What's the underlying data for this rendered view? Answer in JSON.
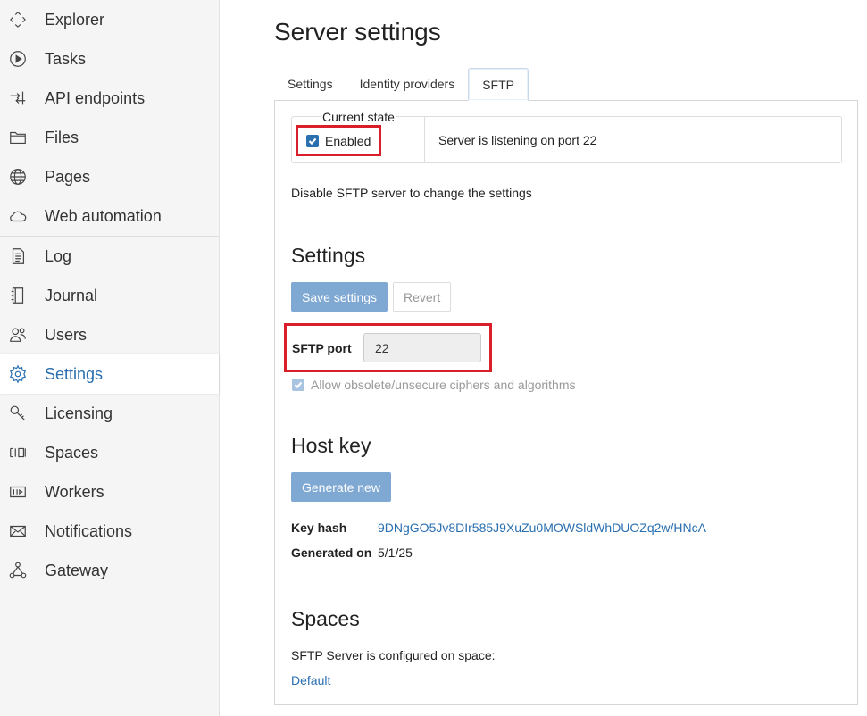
{
  "sidebar": {
    "items": [
      {
        "label": "Explorer",
        "icon": "diamond-arrows-icon"
      },
      {
        "label": "Tasks",
        "icon": "play-circle-icon"
      },
      {
        "label": "API endpoints",
        "icon": "api-arrows-icon"
      },
      {
        "label": "Files",
        "icon": "folder-icon"
      },
      {
        "label": "Pages",
        "icon": "globe-icon"
      },
      {
        "label": "Web automation",
        "icon": "cloud-icon"
      },
      {
        "label": "Log",
        "icon": "document-icon"
      },
      {
        "label": "Journal",
        "icon": "notebook-icon"
      },
      {
        "label": "Users",
        "icon": "users-icon"
      },
      {
        "label": "Settings",
        "icon": "gear-icon"
      },
      {
        "label": "Licensing",
        "icon": "key-icon"
      },
      {
        "label": "Spaces",
        "icon": "spaces-icon"
      },
      {
        "label": "Workers",
        "icon": "workers-icon"
      },
      {
        "label": "Notifications",
        "icon": "envelope-icon"
      },
      {
        "label": "Gateway",
        "icon": "gateway-icon"
      }
    ],
    "active": "Settings"
  },
  "page": {
    "title": "Server settings"
  },
  "tabs": [
    {
      "label": "Settings"
    },
    {
      "label": "Identity providers"
    },
    {
      "label": "SFTP"
    }
  ],
  "active_tab": "SFTP",
  "state": {
    "legend": "Current state",
    "enabled_label": "Enabled",
    "enabled": true,
    "status": "Server is listening on port 22"
  },
  "hint": "Disable SFTP server to change the settings",
  "settings": {
    "title": "Settings",
    "save_label": "Save settings",
    "revert_label": "Revert",
    "port_label": "SFTP port",
    "port_value": "22",
    "cipher_label": "Allow obsolete/unsecure ciphers and algorithms",
    "cipher_checked": true
  },
  "host_key": {
    "title": "Host key",
    "generate_label": "Generate new",
    "hash_label": "Key hash",
    "hash_value": "9DNgGO5Jv8DIr585J9XuZu0MOWSldWhDUOZq2w/HNcA",
    "generated_label": "Generated on",
    "generated_value": "5/1/25"
  },
  "spaces": {
    "title": "Spaces",
    "text": "SFTP Server is configured on space:",
    "link": "Default"
  },
  "colors": {
    "accent": "#2a6fb0",
    "highlight": "#d9202a",
    "primary_button": "#7fa8d3"
  }
}
